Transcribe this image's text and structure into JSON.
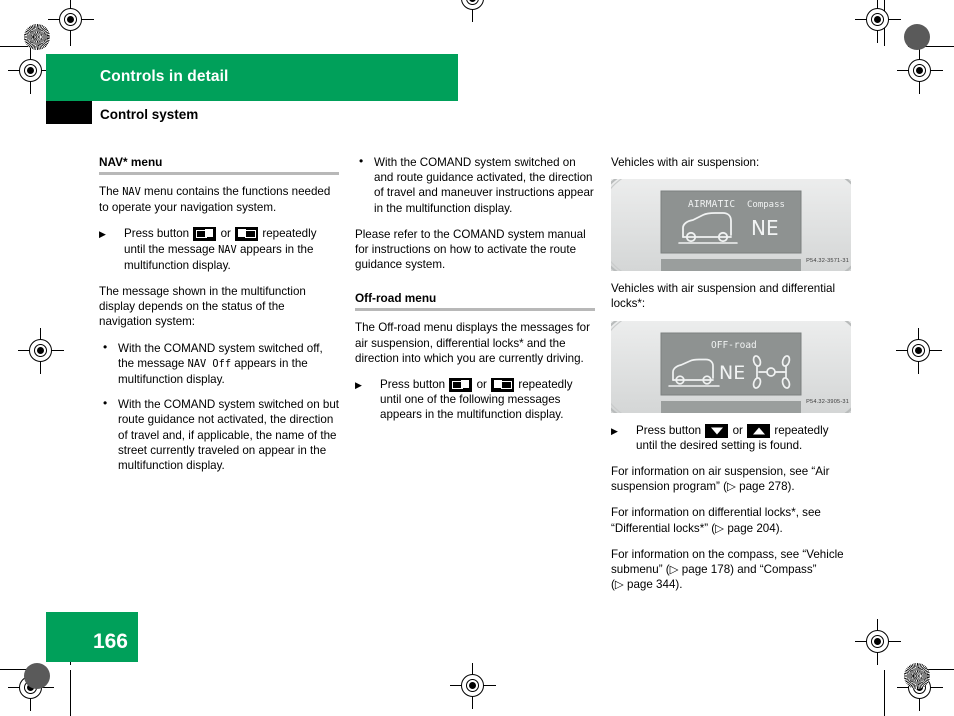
{
  "header": {
    "chapter": "Controls in detail",
    "section": "Control system"
  },
  "footer": {
    "page_number": "166"
  },
  "colors": {
    "brand_green": "#00a05a",
    "rule_grey": "#b8b8b8"
  },
  "column1": {
    "heading": "NAV* menu",
    "intro_a": "The ",
    "intro_mono": "NAV",
    "intro_b": " menu contains the functions needed to operate your navigation system.",
    "action1_a": "Press button",
    "action1_or": "or",
    "action1_b": "repeatedly until the message",
    "action1_mono": "NAV",
    "action1_c": "appears in the multifunction display.",
    "para2": "The message shown in the multifunction display depends on the status of the navigation system:",
    "bullet1_a": "With the COMAND system switched off, the message",
    "bullet1_mono": "NAV Off",
    "bullet1_b": "appears in the multifunction display.",
    "bullet2": "With the COMAND system switched on but route guidance not activated, the direction of travel and, if applicable, the name of the street currently traveled on appear in the multifunction display."
  },
  "column2": {
    "bullet1": "With the COMAND system switched on and route guidance activated, the direction of travel and maneuver instructions appear in the multifunction display.",
    "para1": "Please refer to the COMAND system manual for instructions on how to activate the route guidance system.",
    "heading": "Off-road menu",
    "para2": "The Off-road menu displays the messages for air suspension, differential locks* and the direction into which you are currently driving.",
    "action1_a": "Press button",
    "action1_or": "or",
    "action1_b": "repeatedly until one of the following messages appears in the multifunction display."
  },
  "column3": {
    "caption1": "Vehicles with air suspension:",
    "figure1": {
      "label_left": "AIRMATIC",
      "label_right": "Compass",
      "compass_value": "NE",
      "code": "P54.32-3571-31"
    },
    "caption2": "Vehicles with air suspension and differential locks*:",
    "figure2": {
      "label_top": "OFF-road",
      "compass_value": "NE",
      "code": "P54.32-3905-31"
    },
    "action1_a": "Press button",
    "action1_or": "or",
    "action1_b": "repeatedly until the desired setting is found.",
    "ref1_a": "For information on air suspension, see “Air suspension program” (",
    "ref1_page": "page 278",
    "ref1_b": ").",
    "ref2_a": "For information on differential locks*, see “Differential locks*” (",
    "ref2_page": "page 204",
    "ref2_b": ").",
    "ref3_a": "For information on the compass, see “Vehicle submenu” (",
    "ref3_page": "page 178",
    "ref3_mid": ") and “Compass” (",
    "ref3_page2": "page 344",
    "ref3_b": ")."
  },
  "icons": {
    "mfd_button_left": "mfd-button-left-icon",
    "mfd_button_right": "mfd-button-right-icon",
    "mfd_button_down": "mfd-button-down-icon",
    "mfd_button_up": "mfd-button-up-icon",
    "page_ref": "▷"
  }
}
